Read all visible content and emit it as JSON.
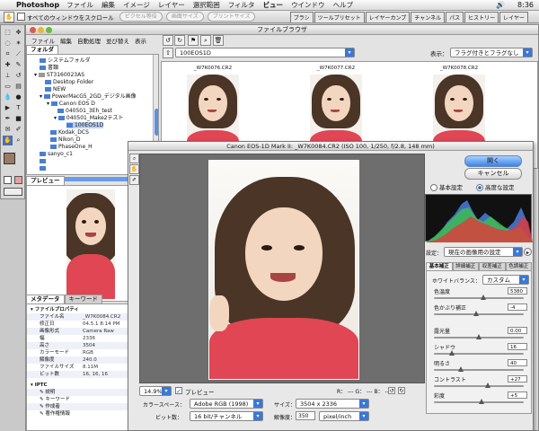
{
  "menubar": {
    "app": "Photoshop",
    "items": [
      "ファイル",
      "編集",
      "イメージ",
      "レイヤー",
      "選択範囲",
      "フィルタ",
      "ビュー",
      "ウインドウ",
      "ヘルプ"
    ],
    "active": "ビュー",
    "clock": "8:36"
  },
  "options": {
    "scroll_all": "すべてのウィンドウをスクロール",
    "btn_actual": "ピクセル等倍",
    "btn_fit": "画面サイズ",
    "btn_print": "プリントサイズ"
  },
  "wells": [
    "ブラシ",
    "ツールプリセット",
    "レイヤーカンプ",
    "チャンネル",
    "パス",
    "ヒストリー",
    "レイヤー"
  ],
  "filebrowser": {
    "title": "ファイルブラウザ",
    "menu": [
      "ファイル",
      "編集",
      "自動処理",
      "並び替え",
      "表示"
    ],
    "folder_tab": "フォルダ",
    "location": "100EOS1D",
    "view_label": "表示：",
    "view_value": "フラグ付きとフラグなし",
    "tree": [
      {
        "label": "システムフォルダ",
        "depth": 1
      },
      {
        "label": "書類",
        "depth": 1
      },
      {
        "label": "ST3160023AS",
        "depth": 1
      },
      {
        "label": "Desktop Folder",
        "depth": 2
      },
      {
        "label": "NEW",
        "depth": 2
      },
      {
        "label": "PowerMacG5_2GD_デジタル画像",
        "depth": 2
      },
      {
        "label": "Canon EOS D",
        "depth": 3
      },
      {
        "label": "040501_3Eh_test",
        "depth": 4
      },
      {
        "label": "040501_Make2テスト",
        "depth": 4
      },
      {
        "label": "100EOS1D",
        "depth": 5
      },
      {
        "label": "Kodak_DCS",
        "depth": 3
      },
      {
        "label": "Nikon_D",
        "depth": 3
      },
      {
        "label": "PhaseOne_H",
        "depth": 3
      },
      {
        "label": "sanyo_c1",
        "depth": 2
      },
      {
        "label": "",
        "depth": 2
      },
      {
        "label": "",
        "depth": 2
      }
    ],
    "preview_tab": "プレビュー",
    "meta_tabs": [
      "メタデータ",
      "キーワード"
    ],
    "meta_section": "ファイルプロパティ",
    "meta": [
      {
        "k": "ファイル名",
        "v": "_W7K0084.CR2"
      },
      {
        "k": "修正日",
        "v": "04.5.1 8:14 PM"
      },
      {
        "k": "画像形式",
        "v": "Camera Raw"
      },
      {
        "k": "幅",
        "v": "2336"
      },
      {
        "k": "高さ",
        "v": "3504"
      },
      {
        "k": "カラーモード",
        "v": "RGB"
      },
      {
        "k": "解像度",
        "v": "240.0"
      },
      {
        "k": "ファイルサイズ",
        "v": "8.11M"
      },
      {
        "k": "ビット数",
        "v": "16, 16, 16"
      }
    ],
    "meta_more": [
      "IPTC",
      "説明",
      "キーワード",
      "作成者",
      "著作権情報"
    ],
    "thumbs": [
      "_W7K0076.CR2",
      "_W7K0077.CR2",
      "_W7K0078.CR2"
    ]
  },
  "raw": {
    "title": "Canon EOS-1D Mark II:  _W7K0084.CR2  (ISO 100, 1/250, f/2.8, 148 mm)",
    "ok": "開く",
    "cancel": "キャンセル",
    "basic": "基本設定",
    "advanced": "高度な設定",
    "settings_label": "設定：",
    "settings_value": "現在の画像用の設定",
    "tabs": [
      "基本補正",
      "詳細補正",
      "収差補正",
      "色調補正"
    ],
    "wb_label": "ホワイトバランス：",
    "wb_value": "カスタム",
    "sliders": [
      {
        "label": "色温度",
        "value": "5380",
        "pos": 0.55
      },
      {
        "label": "色かぶり補正",
        "value": "-4",
        "pos": 0.47
      },
      {
        "label": "露光量",
        "value": "0.00",
        "pos": 0.5
      },
      {
        "label": "シャドウ",
        "value": "16",
        "pos": 0.2
      },
      {
        "label": "明るさ",
        "value": "40",
        "pos": 0.3
      },
      {
        "label": "コントラスト",
        "value": "+27",
        "pos": 0.6
      },
      {
        "label": "彩度",
        "value": "+5",
        "pos": 0.53
      }
    ],
    "zoom": "14.9%",
    "preview": "プレビュー",
    "rgb": "R： ---  G： ---  B： ---",
    "colorspace_label": "カラースペース：",
    "colorspace": "Adobe RGB (1998)",
    "size_label": "サイズ：",
    "size": "3504 x 2336",
    "depth_label": "ビット数：",
    "depth": "16 bit/チャンネル",
    "res_label": "解像度：",
    "res": "350",
    "res_unit": "pixel/inch"
  }
}
